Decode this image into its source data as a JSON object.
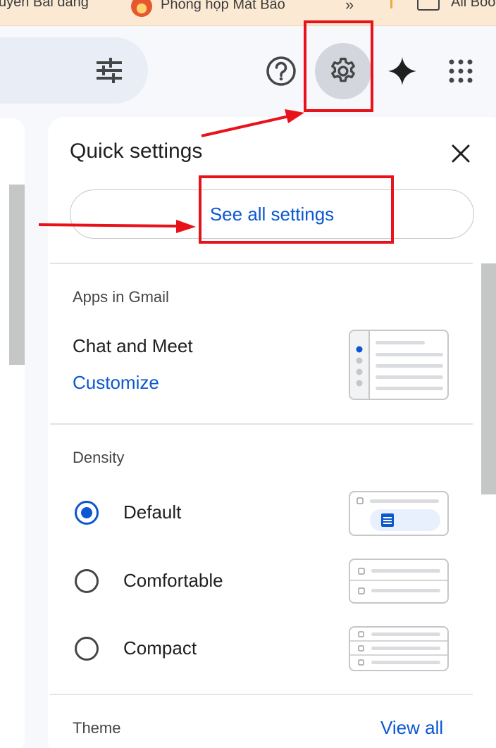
{
  "bookmarks": [
    {
      "label": "uyễn Bài đăng"
    },
    {
      "label": "Phòng họp Mắt Bão"
    },
    {
      "label": "»"
    },
    {
      "label": "All Boo"
    }
  ],
  "topbar": {
    "icons": [
      "tune-icon",
      "help-icon",
      "settings-gear-icon",
      "gemini-sparkle-icon",
      "apps-grid-icon"
    ]
  },
  "quick_settings": {
    "title": "Quick settings",
    "close_icon": "close-icon",
    "see_all_label": "See all settings",
    "apps_section": {
      "heading": "Apps in Gmail",
      "item_label": "Chat and Meet",
      "action_label": "Customize"
    },
    "density_section": {
      "heading": "Density",
      "options": [
        {
          "label": "Default",
          "selected": true
        },
        {
          "label": "Comfortable",
          "selected": false
        },
        {
          "label": "Compact",
          "selected": false
        }
      ]
    },
    "theme_section": {
      "heading": "Theme",
      "action_label": "View all"
    }
  },
  "colors": {
    "accent": "#0b57d0",
    "annotation": "#e8121b",
    "panel_bg": "#ffffff",
    "page_bg": "#f6f8fc"
  }
}
